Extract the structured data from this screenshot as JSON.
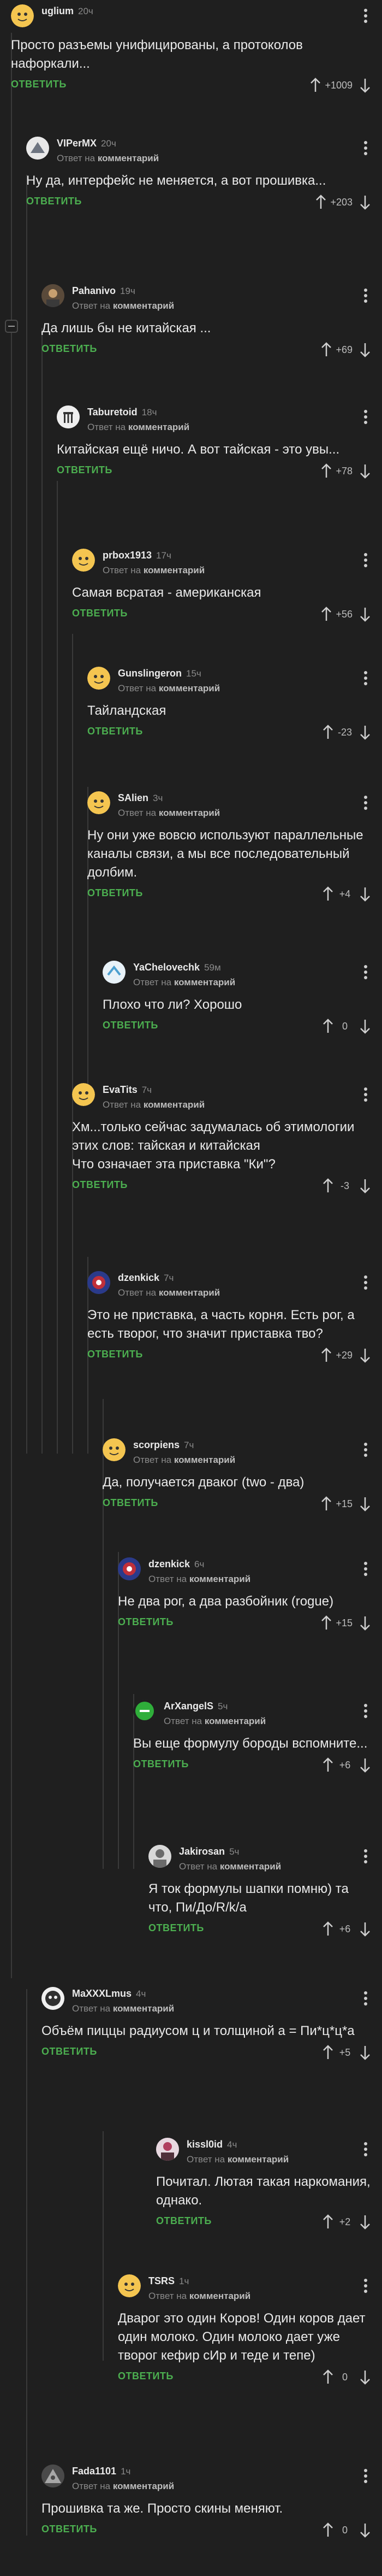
{
  "labels": {
    "reply_to": "Ответ на",
    "reply_to_target": "комментарий",
    "reply_button": "ОТВЕТИТЬ"
  },
  "comments": [
    {
      "user": "uglium",
      "time": "20ч",
      "text": "Просто разъемы унифицированы, а протоколов нафоркали...",
      "score": "+1009",
      "avatar_color": "#d9a33a"
    },
    {
      "user": "VIPerMX",
      "time": "20ч",
      "text": "Ну да, интерфейс не меняется, а вот прошивка...",
      "score": "+203",
      "avatar_color": "#8a8f99"
    },
    {
      "user": "Pahanivo",
      "time": "19ч",
      "text": "Да лишь бы не китайская ...",
      "score": "+69",
      "avatar_color": "#b08a55"
    },
    {
      "user": "Taburetoid",
      "time": "18ч",
      "text": "Китайская ещё ничо. А вот тайская - это увы...",
      "score": "+78",
      "avatar_color": "#d8d8d8"
    },
    {
      "user": "prbox1913",
      "time": "17ч",
      "text": "Самая всратая - американская",
      "score": "+56",
      "avatar_color": "#e0b040"
    },
    {
      "user": "Gunslingeron",
      "time": "15ч",
      "text": "Тайландская",
      "score": "-23",
      "avatar_color": "#e0b040"
    },
    {
      "user": "SAlien",
      "time": "3ч",
      "text": "Ну они уже вовсю используют параллельные каналы связи, а мы все последовательный долбим.",
      "score": "+4",
      "avatar_color": "#e0b040"
    },
    {
      "user": "YaChelovechk",
      "time": "59м",
      "text": "Плохо что ли? Хорошо",
      "score": "0",
      "avatar_color": "#4ca0d0"
    },
    {
      "user": "EvaTits",
      "time": "7ч",
      "text": "Хм...только сейчас задумалась об этимологии этих слов: тайская и китайская\nЧто означает эта приставка \"Ки\"?",
      "score": "-3",
      "avatar_color": "#e0b040"
    },
    {
      "user": "dzenkick",
      "time": "7ч",
      "text": "Это не приставка, а часть корня. Есть рог, а есть творог, что значит приставка тво?",
      "score": "+29",
      "avatar_color": "#c0303a"
    },
    {
      "user": "scorpiens",
      "time": "7ч",
      "text": "Да, получается дваког (two - два)",
      "score": "+15",
      "avatar_color": "#e0b040"
    },
    {
      "user": "dzenkick",
      "time": "6ч",
      "text": "Не два рог, а два разбойник (rogue)",
      "score": "+15",
      "avatar_color": "#c0303a"
    },
    {
      "user": "ArXangelS",
      "time": "5ч",
      "text": "Вы еще формулу бороды вспомните...",
      "score": "+6",
      "avatar_color": "#2fae3a"
    },
    {
      "user": "Jakirosan",
      "time": "5ч",
      "text": "Я ток формулы шапки помню) та что, Пи/До/R/k/a",
      "score": "+6",
      "avatar_color": "#9a9a9a"
    },
    {
      "user": "MaXXXLmus",
      "time": "4ч",
      "text": "Объём пиццы радиусом ц и толщиной а = Пи*ц*ц*а",
      "score": "+5",
      "avatar_color": "#e8e8e8"
    },
    {
      "user": "kissl0id",
      "time": "4ч",
      "text": "Почитал. Лютая такая наркомания, однако.",
      "score": "+2",
      "avatar_color": "#b04060"
    },
    {
      "user": "TSRS",
      "time": "1ч",
      "text": "Дварог это один Коров! Один коров дает один молоко. Один молоко дает уже творог кефир сИр и теде и тепе)",
      "score": "0",
      "avatar_color": "#e0b040"
    },
    {
      "user": "Fada1101",
      "time": "1ч",
      "text": "Прошивка та же. Просто скины меняют.",
      "score": "0",
      "avatar_color": "#7a7a7a"
    }
  ]
}
